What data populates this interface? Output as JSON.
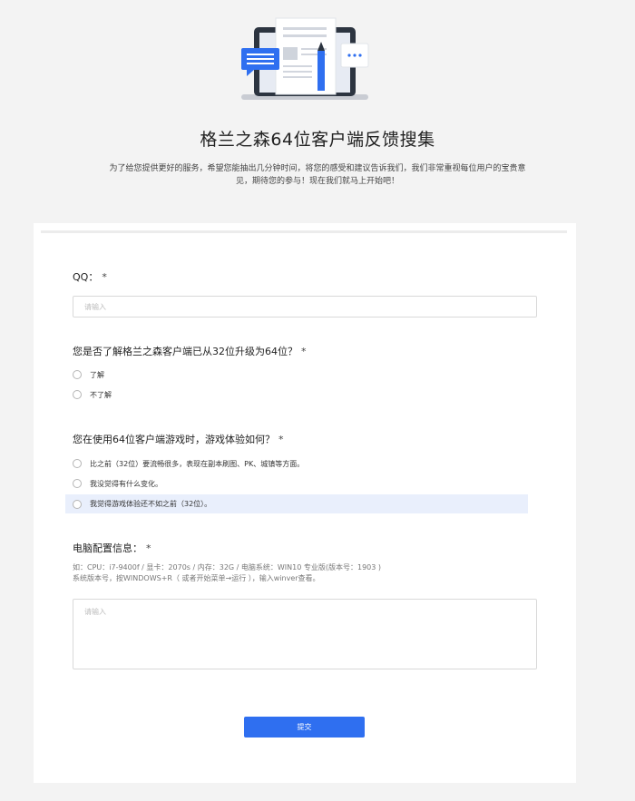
{
  "header": {
    "illustration": "survey-laptop-document-illustration",
    "title": "格兰之森64位客户端反馈搜集",
    "description_line1": "为了给您提供更好的服务，希望您能抽出几分钟时间，将您的感受和建议告诉我们，我们非常重视每位用户的宝贵意",
    "description_line2": "见，期待您的参与！现在我们就马上开始吧！"
  },
  "form": {
    "required_mark": "*",
    "q1": {
      "label": "QQ：",
      "placeholder": "请输入"
    },
    "q2": {
      "label": "您是否了解格兰之森客户端已从32位升级为64位？",
      "options": [
        "了解",
        "不了解"
      ]
    },
    "q3": {
      "label": "您在使用64位客户端游戏时，游戏体验如何？",
      "options": [
        "比之前（32位）要流畅很多，表现在副本刷图、PK、城镇等方面。",
        "我没觉得有什么变化。",
        "我觉得游戏体验还不如之前（32位）。"
      ],
      "highlighted_index": 2
    },
    "q4": {
      "label": "电脑配置信息：",
      "hint_line1": "如：CPU：i7-9400f / 显卡：2070s / 内存：32G / 电脑系统：WIN10 专业版(版本号：1903 )",
      "hint_line2": "系统版本号，按WINDOWS+R（ 或者开始菜单→运行 ），输入winver查看。",
      "placeholder": "请输入"
    },
    "submit_label": "提交"
  },
  "colors": {
    "accent": "#2f6ff0",
    "highlight": "#e9effc",
    "page_bg": "#f3f3f3"
  }
}
